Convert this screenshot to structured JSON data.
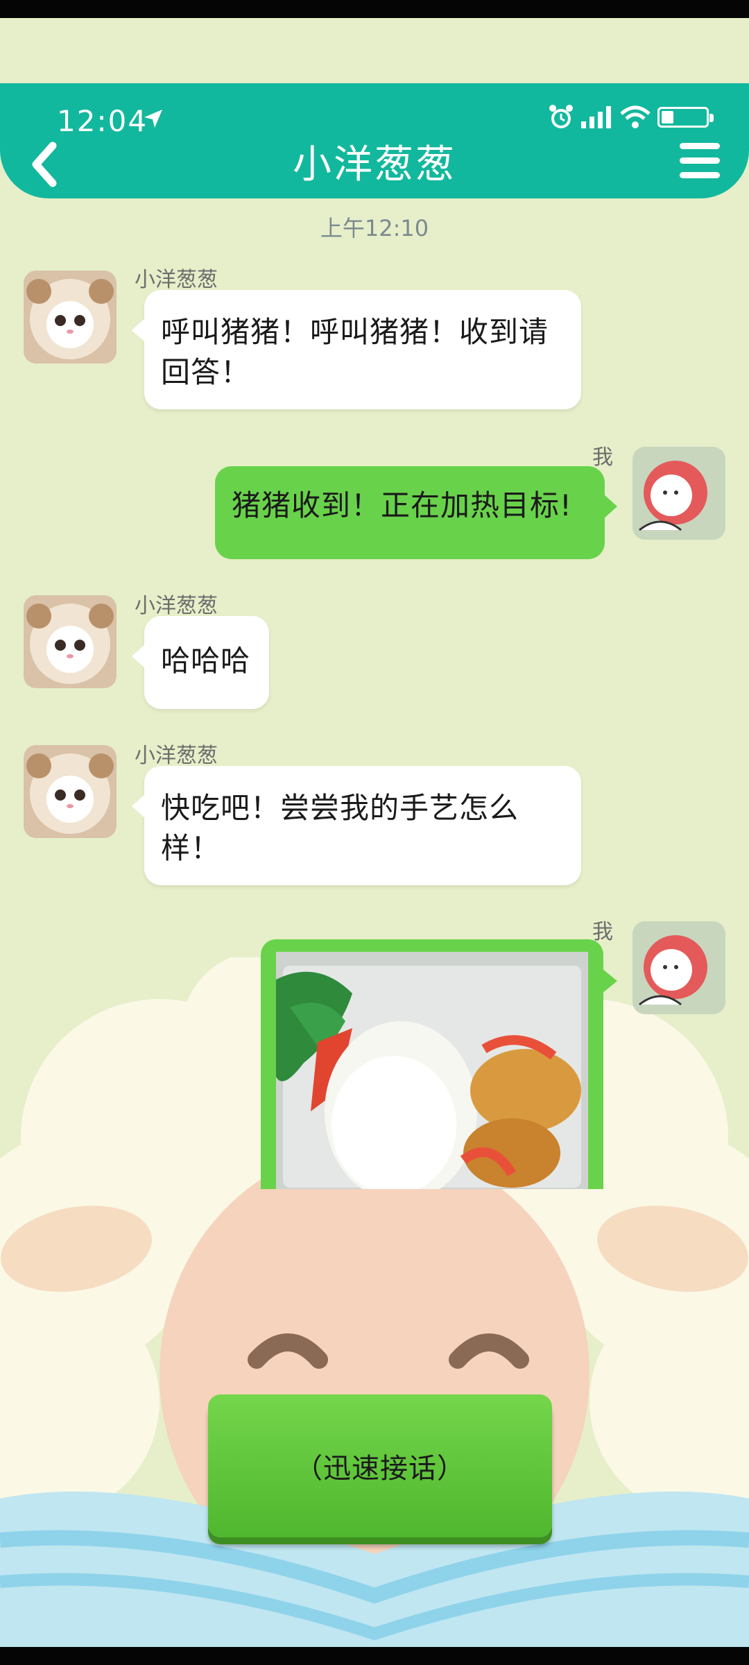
{
  "status_bar": {
    "time": "12:04",
    "battery_level": 0.28,
    "icons": [
      "location-arrow-icon",
      "alarm-icon",
      "signal-icon",
      "wifi-icon",
      "battery-icon"
    ]
  },
  "header": {
    "title": "小洋葱葱",
    "back_icon": "chevron-left-icon",
    "menu_icon": "hamburger-menu-icon",
    "color": "#12b89d"
  },
  "chat": {
    "timestamp": "上午12:10",
    "messages": [
      {
        "side": "left",
        "sender": "小洋葱葱",
        "text": "呼叫猪猪！呼叫猪猪！收到请回答！"
      },
      {
        "side": "right",
        "sender": "我",
        "text": "猪猪收到！正在加热目标!"
      },
      {
        "side": "left",
        "sender": "小洋葱葱",
        "text": "哈哈哈"
      },
      {
        "side": "left",
        "sender": "小洋葱葱",
        "text": "快吃吧！尝尝我的手艺怎么样！"
      },
      {
        "side": "right",
        "sender": "我",
        "image": "food-photo"
      }
    ]
  },
  "answer_button": {
    "label": "（迅速接话）",
    "color": "#69d24b"
  },
  "colors": {
    "background": "#e6efc9",
    "my_bubble": "#69d24b",
    "their_bubble": "#ffffff"
  }
}
